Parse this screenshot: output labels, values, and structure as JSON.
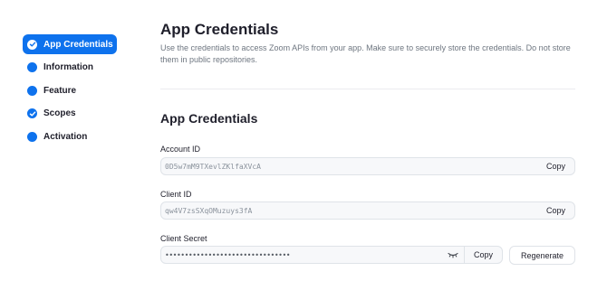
{
  "sidebar": {
    "items": [
      {
        "label": "App Credentials",
        "icon": "check-circle-icon",
        "active": true
      },
      {
        "label": "Information",
        "icon": "dot-icon",
        "active": false
      },
      {
        "label": "Feature",
        "icon": "dot-icon",
        "active": false
      },
      {
        "label": "Scopes",
        "icon": "check-circle-icon",
        "active": false
      },
      {
        "label": "Activation",
        "icon": "dot-icon",
        "active": false
      }
    ]
  },
  "header": {
    "title": "App Credentials",
    "description": "Use the credentials to access Zoom APIs from your app. Make sure to securely store the credentials. Do not store them in public repositories."
  },
  "credentials": {
    "section_title": "App Credentials",
    "account_id": {
      "label": "Account ID",
      "value": "0D5w7mM9TXevlZKlfaXVcA",
      "copy_label": "Copy"
    },
    "client_id": {
      "label": "Client ID",
      "value": "qw4V7zsSXqOMuzuys3fA",
      "copy_label": "Copy"
    },
    "client_secret": {
      "label": "Client Secret",
      "value": "••••••••••••••••••••••••••••••••",
      "copy_label": "Copy",
      "regenerate_label": "Regenerate",
      "reveal_icon": "eye-closed-icon"
    }
  },
  "colors": {
    "accent": "#0e72ed"
  }
}
